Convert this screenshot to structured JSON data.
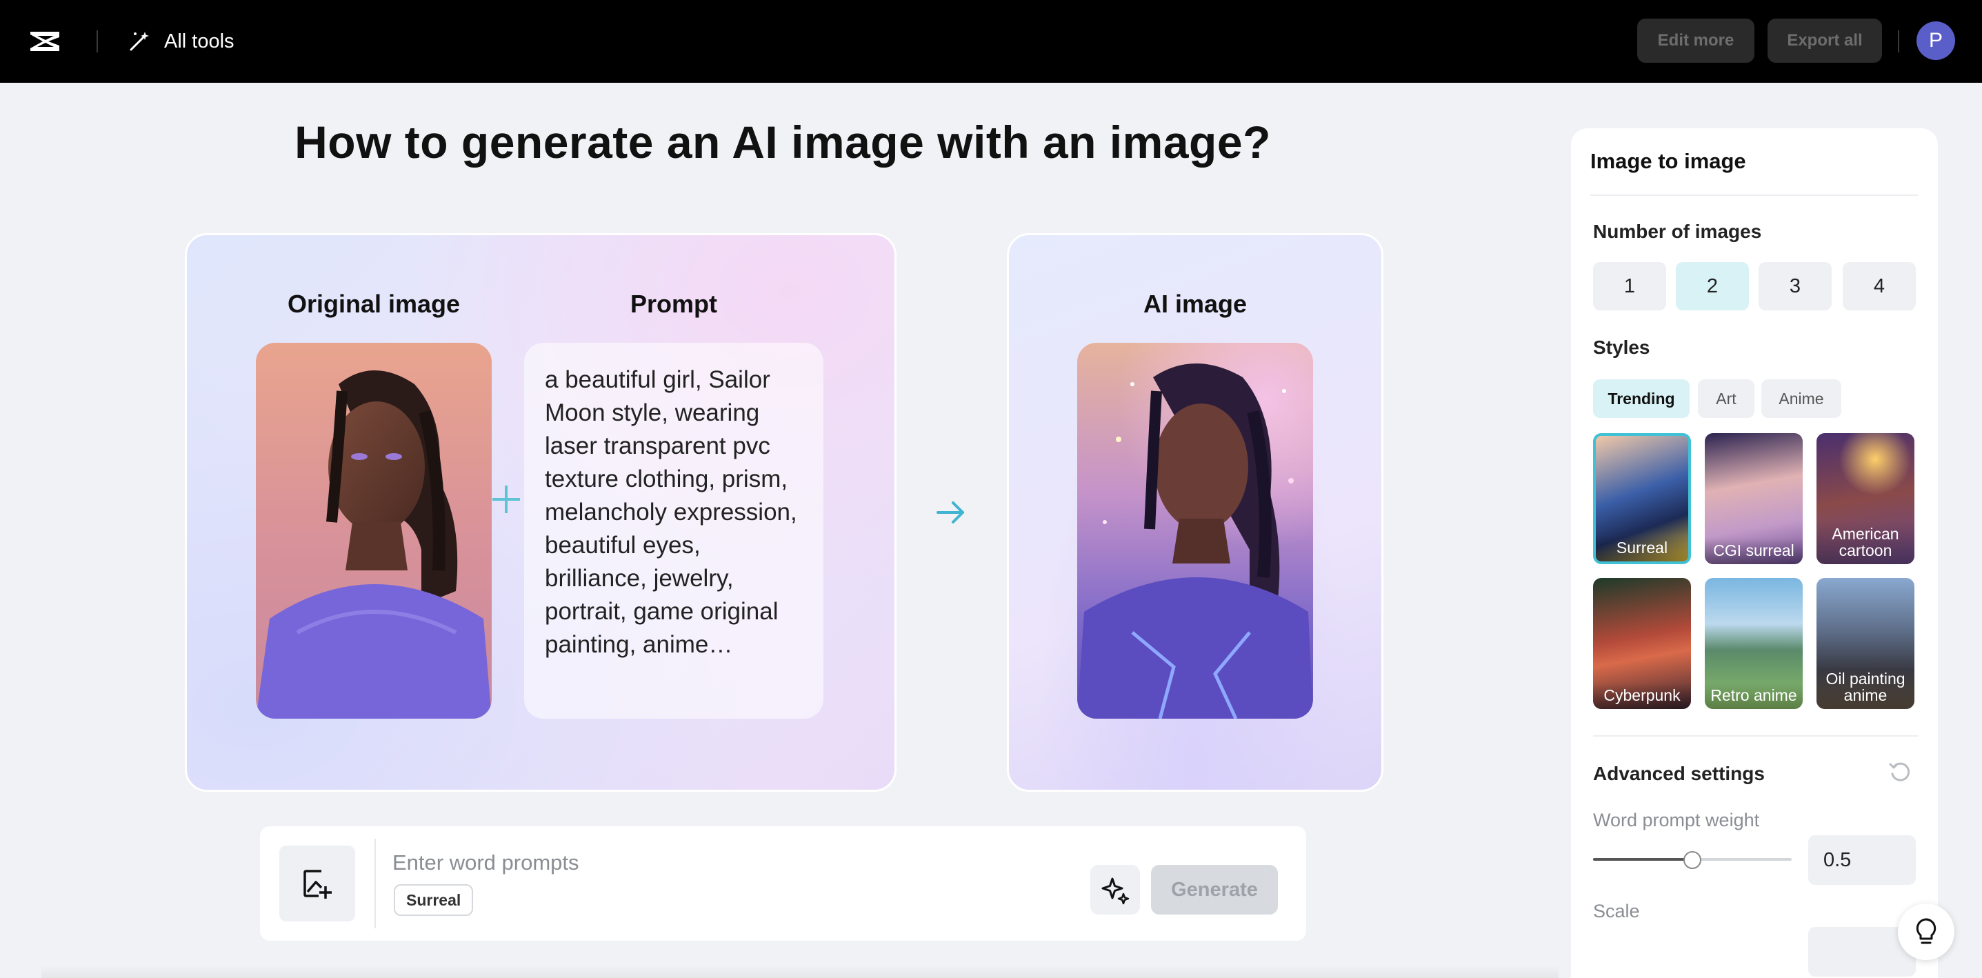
{
  "topbar": {
    "logo_icon": "capcut-logo-icon",
    "all_tools_icon": "magic-wand-icon",
    "all_tools_label": "All tools",
    "edit_more_label": "Edit more",
    "export_all_label": "Export all",
    "avatar_initial": "P"
  },
  "main": {
    "heading": "How to generate an AI image with an image?",
    "original_label": "Original image",
    "prompt_label": "Prompt",
    "prompt_text": "a beautiful girl, Sailor Moon style, wearing laser transparent pvc texture clothing, prism, melancholy expression, beautiful eyes, brilliance, jewelry, portrait, game original painting, anime…",
    "ai_label": "AI image",
    "plus_icon": "plus-icon",
    "arrow_icon": "arrow-right-icon"
  },
  "input_bar": {
    "placeholder": "Enter word prompts",
    "style_chip": "Surreal",
    "generate_label": "Generate",
    "upload_icon": "add-image-icon",
    "magic_icon": "sparkle-icon"
  },
  "panel": {
    "title": "Image to image",
    "number_label": "Number of images",
    "numbers": [
      "1",
      "2",
      "3",
      "4"
    ],
    "selected_number": "2",
    "styles_label": "Styles",
    "style_tabs": [
      "Trending",
      "Art",
      "Anime"
    ],
    "active_tab": "Trending",
    "style_tiles": [
      {
        "label": "Surreal",
        "selected": true
      },
      {
        "label": "CGI surreal",
        "selected": false
      },
      {
        "label": "American cartoon",
        "selected": false
      },
      {
        "label": "Cyberpunk",
        "selected": false
      },
      {
        "label": "Retro anime",
        "selected": false
      },
      {
        "label": "Oil painting anime",
        "selected": false
      }
    ],
    "advanced_label": "Advanced settings",
    "reset_icon": "reset-icon",
    "word_weight_label": "Word prompt weight",
    "word_weight_value": "0.5",
    "word_weight_fraction": 0.5,
    "scale_label": "Scale"
  },
  "help_icon": "lightbulb-icon",
  "colors": {
    "accent": "#40c1d5",
    "selected_bg": "#d9f2f5",
    "topbar_bg": "#000000"
  }
}
